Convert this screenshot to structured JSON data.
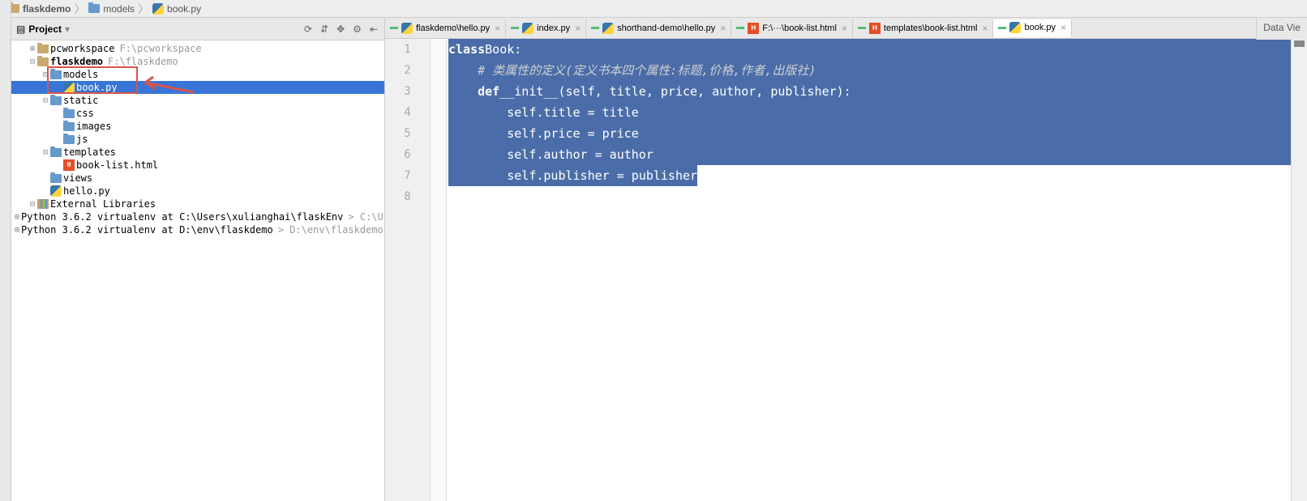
{
  "breadcrumb": [
    {
      "icon": "folder",
      "label": "flaskdemo"
    },
    {
      "icon": "folder",
      "label": "models"
    },
    {
      "icon": "py",
      "label": "book.py"
    }
  ],
  "sidebar": {
    "title": "Project",
    "tools": [
      "⟳",
      "⇵",
      "✥",
      "⚙",
      "⇤"
    ]
  },
  "tree": [
    {
      "depth": 1,
      "exp": "⊞",
      "icon": "folder",
      "name": "pcworkspace",
      "path": "F:\\pcworkspace"
    },
    {
      "depth": 1,
      "exp": "⊟",
      "icon": "folder",
      "name": "flaskdemo",
      "path": "F:\\flaskdemo",
      "bold": true
    },
    {
      "depth": 2,
      "exp": "⊟",
      "icon": "folder-blue",
      "name": "models"
    },
    {
      "depth": 3,
      "exp": "",
      "icon": "py",
      "name": "book.py",
      "selected": true
    },
    {
      "depth": 2,
      "exp": "⊟",
      "icon": "folder-blue",
      "name": "static"
    },
    {
      "depth": 3,
      "exp": "",
      "icon": "folder-blue",
      "name": "css"
    },
    {
      "depth": 3,
      "exp": "",
      "icon": "folder-blue",
      "name": "images"
    },
    {
      "depth": 3,
      "exp": "",
      "icon": "folder-blue",
      "name": "js"
    },
    {
      "depth": 2,
      "exp": "⊟",
      "icon": "folder-blue",
      "name": "templates"
    },
    {
      "depth": 3,
      "exp": "",
      "icon": "html",
      "name": "book-list.html"
    },
    {
      "depth": 2,
      "exp": "",
      "icon": "folder-blue",
      "name": "views"
    },
    {
      "depth": 2,
      "exp": "",
      "icon": "py",
      "name": "hello.py"
    },
    {
      "depth": 1,
      "exp": "⊟",
      "icon": "lib",
      "name": "External Libraries"
    },
    {
      "depth": 2,
      "exp": "⊞",
      "icon": "py",
      "name": "Python 3.6.2 virtualenv at C:\\Users\\xulianghai\\flaskEnv",
      "path": "> C:\\Users"
    },
    {
      "depth": 2,
      "exp": "⊞",
      "icon": "py",
      "name": "Python 3.6.2 virtualenv at D:\\env\\flaskdemo",
      "path": "> D:\\env\\flaskdemo\\Scr"
    }
  ],
  "tabs": [
    {
      "icon": "py",
      "label": "flaskdemo\\hello.py",
      "active": false
    },
    {
      "icon": "py",
      "label": "index.py",
      "active": false
    },
    {
      "icon": "py",
      "label": "shorthand-demo\\hello.py",
      "active": false
    },
    {
      "icon": "html",
      "label": "F:\\···\\book-list.html",
      "active": false
    },
    {
      "icon": "html",
      "label": "templates\\book-list.html",
      "active": false
    },
    {
      "icon": "py",
      "label": "book.py",
      "active": true
    }
  ],
  "code": {
    "lines": [
      {
        "n": 1,
        "seg": [
          {
            "t": "class ",
            "cls": "kw"
          },
          {
            "t": "Book:",
            "cls": "cname"
          }
        ],
        "full": true,
        "indent": 0
      },
      {
        "n": 2,
        "seg": [
          {
            "t": "# 类属性的定义(定义书本四个属性:标题,价格,作者,出版社)",
            "cls": "comment"
          }
        ],
        "full": true,
        "indent": 1
      },
      {
        "n": 3,
        "seg": [
          {
            "t": "def ",
            "cls": "kw"
          },
          {
            "t": "__init__(self, title, price, author, publisher):",
            "cls": ""
          }
        ],
        "full": true,
        "indent": 1
      },
      {
        "n": 4,
        "seg": [
          {
            "t": "self.title = title",
            "cls": ""
          }
        ],
        "full": true,
        "indent": 2
      },
      {
        "n": 5,
        "seg": [
          {
            "t": "self.price = price",
            "cls": ""
          }
        ],
        "full": true,
        "indent": 2
      },
      {
        "n": 6,
        "seg": [
          {
            "t": "self.author = author",
            "cls": ""
          }
        ],
        "full": true,
        "indent": 2
      },
      {
        "n": 7,
        "seg": [
          {
            "t": "self.publisher = publisher",
            "cls": ""
          }
        ],
        "full": false,
        "indent": 2
      },
      {
        "n": 8,
        "seg": [],
        "full": false,
        "indent": 0
      }
    ]
  },
  "right_panel": "Data Vie"
}
